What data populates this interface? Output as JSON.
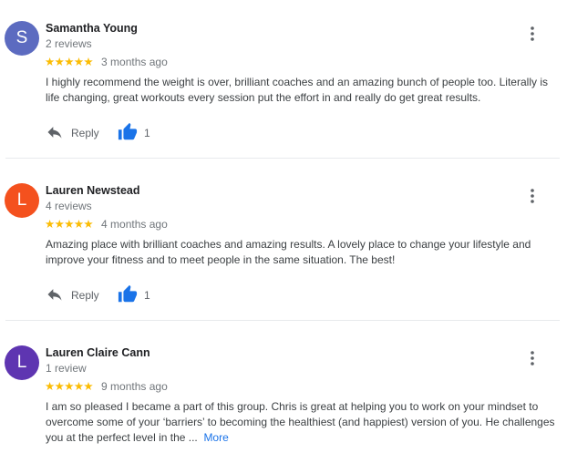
{
  "reviews": [
    {
      "initial": "S",
      "avatar_color": "#5c6bc0",
      "name": "Samantha Young",
      "review_count": "2 reviews",
      "stars": "★★★★★",
      "time": "3 months ago",
      "text": "I highly recommend the weight is over, brilliant coaches and an amazing bunch of people too. Literally is life changing, great workouts every session put the effort in and really do get great results.",
      "more": "",
      "reply_label": "Reply",
      "likes": "1"
    },
    {
      "initial": "L",
      "avatar_color": "#f4511e",
      "name": "Lauren Newstead",
      "review_count": "4 reviews",
      "stars": "★★★★★",
      "time": "4 months ago",
      "text": "Amazing place with brilliant coaches and amazing results. A lovely place to change your lifestyle  and improve your fitness and to meet people in the same situation. The best!",
      "more": "",
      "reply_label": "Reply",
      "likes": "1"
    },
    {
      "initial": "L",
      "avatar_color": "#5e35b1",
      "name": "Lauren Claire Cann",
      "review_count": "1 review",
      "stars": "★★★★★",
      "time": "9 months ago",
      "text": "I am so pleased I became a part of this group. Chris is great at helping you to work on your mindset to overcome some of your ‘barriers’ to becoming the healthiest (and happiest) version of you. He challenges you at the perfect level in the ...",
      "more": "More",
      "reply_label": "",
      "likes": ""
    }
  ]
}
